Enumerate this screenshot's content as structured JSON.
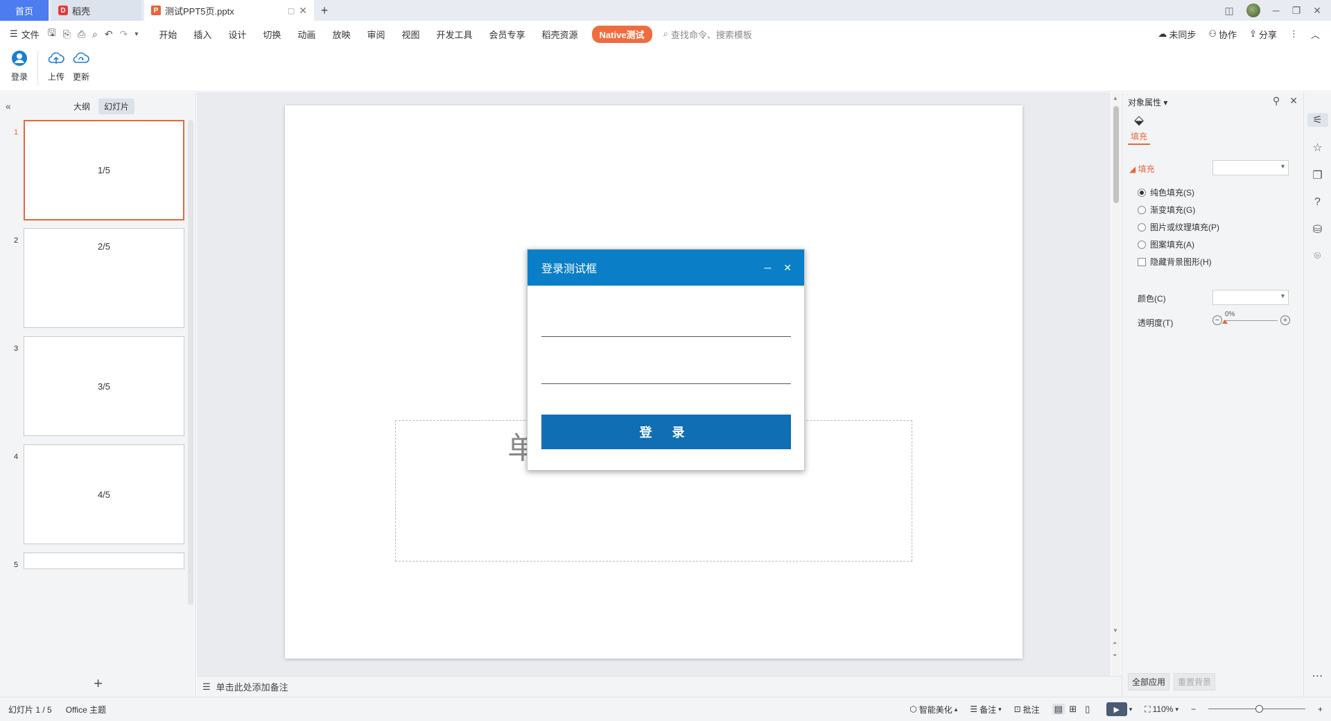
{
  "titlebar": {
    "tabs": [
      {
        "label": "首页"
      },
      {
        "label": "稻壳"
      },
      {
        "label": "测试PPT5页.pptx"
      }
    ],
    "add_tab": "+"
  },
  "menubar": {
    "file_label": "文件",
    "items": [
      "开始",
      "插入",
      "设计",
      "切换",
      "动画",
      "放映",
      "审阅",
      "视图",
      "开发工具",
      "会员专享",
      "稻壳资源"
    ],
    "native_label": "Native测试",
    "search_placeholder": "查找命令、搜索模板",
    "right": {
      "sync": "未同步",
      "collab": "协作",
      "share": "分享"
    }
  },
  "ribbon": {
    "buttons": [
      {
        "label": "登录"
      },
      {
        "label": "上传"
      },
      {
        "label": "更新"
      }
    ]
  },
  "left_panel": {
    "tabs": [
      "大纲",
      "幻灯片"
    ],
    "active_tab": 1,
    "slides": [
      {
        "num": "1",
        "label": "1/5"
      },
      {
        "num": "2",
        "label": "2/5"
      },
      {
        "num": "3",
        "label": "3/5"
      },
      {
        "num": "4",
        "label": "4/5"
      },
      {
        "num": "5",
        "label": ""
      }
    ],
    "add_label": "+"
  },
  "slide": {
    "placeholder_text": "单"
  },
  "notes": {
    "placeholder": "单击此处添加备注"
  },
  "dialog": {
    "title": "登录测试框",
    "username_value": "",
    "password_value": "",
    "login_button": "登 录",
    "colors": {
      "header": "#0a7fc7",
      "button": "#0f6eb4"
    }
  },
  "right_panel": {
    "title": "对象属性",
    "fill_tab": "填充",
    "section": "填充",
    "options": [
      {
        "label": "纯色填充(S)",
        "checked": true
      },
      {
        "label": "渐变填充(G)",
        "checked": false
      },
      {
        "label": "图片或纹理填充(P)",
        "checked": false
      },
      {
        "label": "图案填充(A)",
        "checked": false
      }
    ],
    "hide_bg_label": "隐藏背景图形(H)",
    "color_label": "颜色(C)",
    "transparency_label": "透明度(T)",
    "transparency_value": "0%",
    "apply_all": "全部应用",
    "reset_bg": "重置背景"
  },
  "statusbar": {
    "slide_info": "幻灯片 1 / 5",
    "theme": "Office 主题",
    "beautify": "智能美化",
    "notes": "备注",
    "comments": "批注",
    "zoom": "110%"
  },
  "accent_color": "#e5673a"
}
